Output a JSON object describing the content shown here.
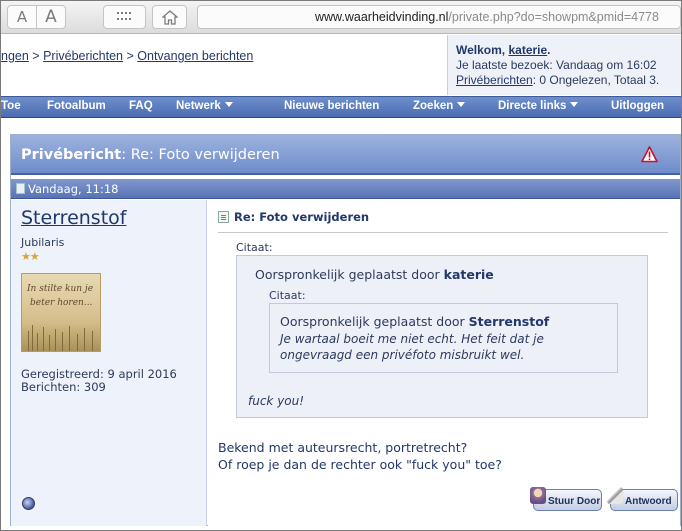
{
  "browser": {
    "font_small": "A",
    "font_large": "A",
    "grid_icon": "grid-icon",
    "home_icon": "home-icon",
    "url_host": "www.waarheidvinding.nl",
    "url_path": "/private.php?do=showpm&pmid=4778"
  },
  "breadcrumb": {
    "item1": "ngen",
    "sep": ">",
    "item2": "Privéberichten",
    "item3": "Ontvangen berichten"
  },
  "welcome": {
    "prefix": "Welkom,",
    "user": "katerie",
    "suffix": ".",
    "last_visit": "Je laatste bezoek: Vandaag om 16:02",
    "pm_link": "Privéberichten",
    "pm_stats": ": 0 Ongelezen, Totaal 3."
  },
  "nav": {
    "items": [
      {
        "label": "Toe",
        "dropdown": false
      },
      {
        "label": "Fotoalbum",
        "dropdown": false
      },
      {
        "label": "FAQ",
        "dropdown": false
      },
      {
        "label": "Netwerk",
        "dropdown": true
      },
      {
        "label": "Nieuwe berichten",
        "dropdown": false
      },
      {
        "label": "Zoeken",
        "dropdown": true
      },
      {
        "label": "Directe links",
        "dropdown": true
      },
      {
        "label": "Uitloggen",
        "dropdown": false
      }
    ]
  },
  "pm": {
    "title_bold": "Privébericht",
    "title_rest": ": Re: Foto verwijderen",
    "date": "Vandaag, 11:18",
    "author": {
      "name": "Sterrenstof",
      "title": "Jubilaris",
      "stars": "★★",
      "avatar_line1": "In stilte kun je",
      "avatar_line2": "beter horen...",
      "registered": "Geregistreerd: 9 april 2016",
      "posts": "Berichten: 309"
    },
    "message": {
      "title": "Re: Foto verwijderen",
      "quote_label": "Citaat:",
      "quote_by": "Oorspronkelijk geplaatst door",
      "quote_author": "katerie",
      "inner_quote_label": "Citaat:",
      "inner_quote_by": "Oorspronkelijk geplaatst door",
      "inner_quote_author": "Sterrenstof",
      "inner_quote_text_1": "Je wartaal boeit me niet echt. Het feit dat je",
      "inner_quote_text_2": "ongevraagd een privéfoto misbruikt wel.",
      "quote_text": "fuck you!",
      "reply_1": "Bekend met auteursrecht, portretrecht?",
      "reply_2": "Of roep je dan de rechter ook \"fuck you\" toe?"
    },
    "buttons": {
      "forward": "Stuur Door",
      "reply": "Antwoord"
    }
  }
}
